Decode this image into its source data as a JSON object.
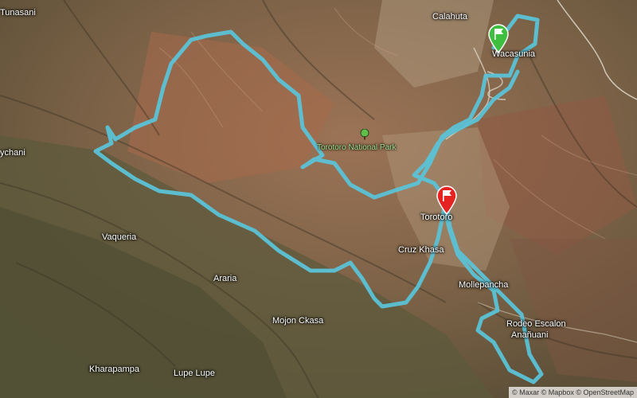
{
  "map": {
    "places": [
      {
        "id": "tunasani",
        "name": "Tunasani"
      },
      {
        "id": "calahuta",
        "name": "Calahuta"
      },
      {
        "id": "wacasunia",
        "name": "Wacasunia"
      },
      {
        "id": "ychani",
        "name": "ychani"
      },
      {
        "id": "vaqueria",
        "name": "Vaqueria"
      },
      {
        "id": "torotoro",
        "name": "Torotoro"
      },
      {
        "id": "cruz-khasa",
        "name": "Cruz Khasa"
      },
      {
        "id": "mollepancha",
        "name": "Mollepancha"
      },
      {
        "id": "araria",
        "name": "Araria"
      },
      {
        "id": "mojon-ckasa",
        "name": "Mojon Ckasa"
      },
      {
        "id": "rodeo-escalon",
        "name": "Rodeo Escalon"
      },
      {
        "id": "ananuani",
        "name": "Anañuani"
      },
      {
        "id": "kharapampa",
        "name": "Kharapampa"
      },
      {
        "id": "lupe-lupe",
        "name": "Lupe Lupe"
      }
    ],
    "park": {
      "name": "Torotoro National Park",
      "icon": "tree-icon"
    },
    "route": {
      "color": "#5bc2d6"
    },
    "markers": {
      "start": {
        "icon": "flag-icon",
        "color": "#3fbf3f"
      },
      "end": {
        "icon": "flag-icon",
        "color": "#e52421"
      }
    },
    "attribution": "© Maxar © Mapbox © OpenStreetMap"
  }
}
